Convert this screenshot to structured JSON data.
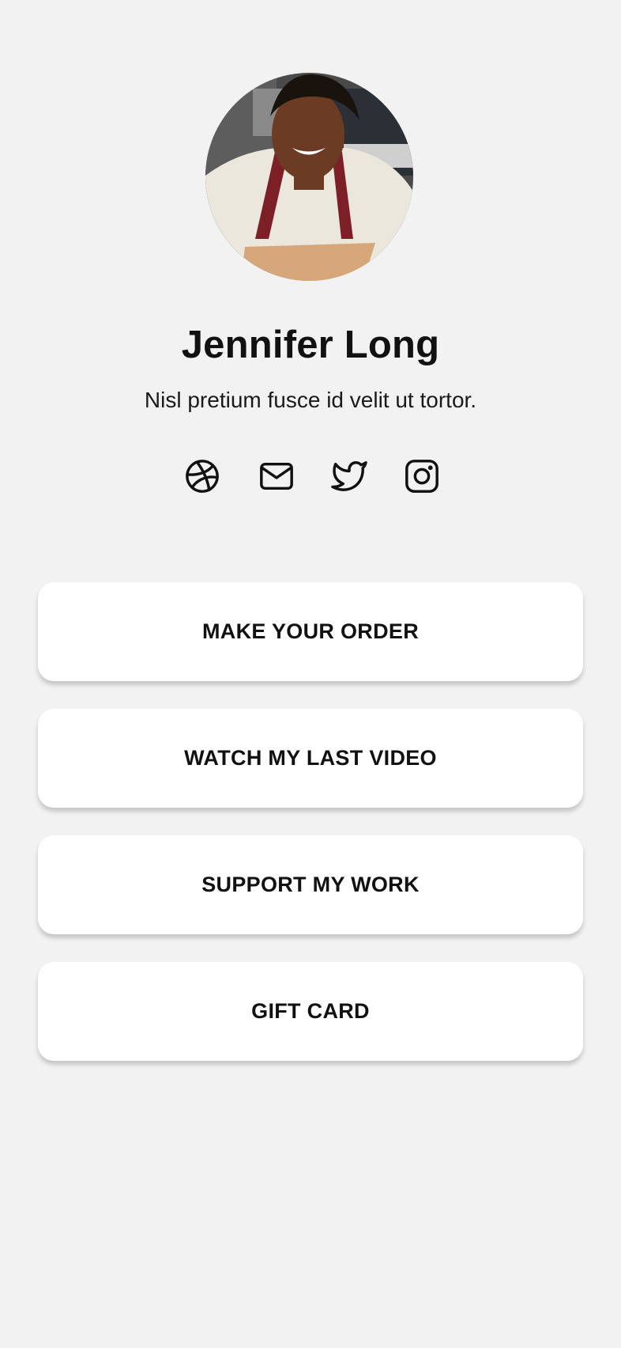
{
  "profile": {
    "name": "Jennifer Long",
    "bio": "Nisl pretium fusce id velit ut tortor."
  },
  "socials": [
    {
      "icon": "dribbble-icon"
    },
    {
      "icon": "mail-icon"
    },
    {
      "icon": "twitter-icon"
    },
    {
      "icon": "instagram-icon"
    }
  ],
  "links": [
    {
      "label": "MAKE YOUR ORDER"
    },
    {
      "label": "WATCH MY LAST VIDEO"
    },
    {
      "label": "SUPPORT MY WORK"
    },
    {
      "label": "GIFT CARD"
    }
  ],
  "colors": {
    "background": "#f2f2f2",
    "card": "#ffffff",
    "text": "#111111"
  }
}
